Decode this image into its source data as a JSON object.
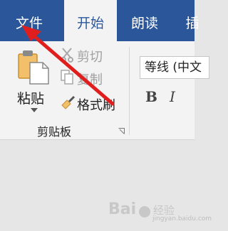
{
  "tabs": [
    {
      "label": "文件",
      "active": false
    },
    {
      "label": "开始",
      "active": true
    },
    {
      "label": "朗读",
      "active": false
    },
    {
      "label": "插",
      "active": false
    }
  ],
  "clipboard": {
    "paste_label": "粘贴",
    "cut_label": "剪切",
    "copy_label": "复制",
    "format_painter_label": "格式刷",
    "group_label": "剪贴板"
  },
  "font": {
    "font_name": "等线 (中文",
    "bold_label": "B",
    "italic_label": "I"
  },
  "watermark": {
    "brand": "Bai",
    "brand_suffix": "经验",
    "domain": "jingyan.baidu.com"
  },
  "colors": {
    "tab_bar": "#2b579a",
    "ribbon": "#f3f3f3",
    "annotation_arrow": "#e01e1e"
  }
}
